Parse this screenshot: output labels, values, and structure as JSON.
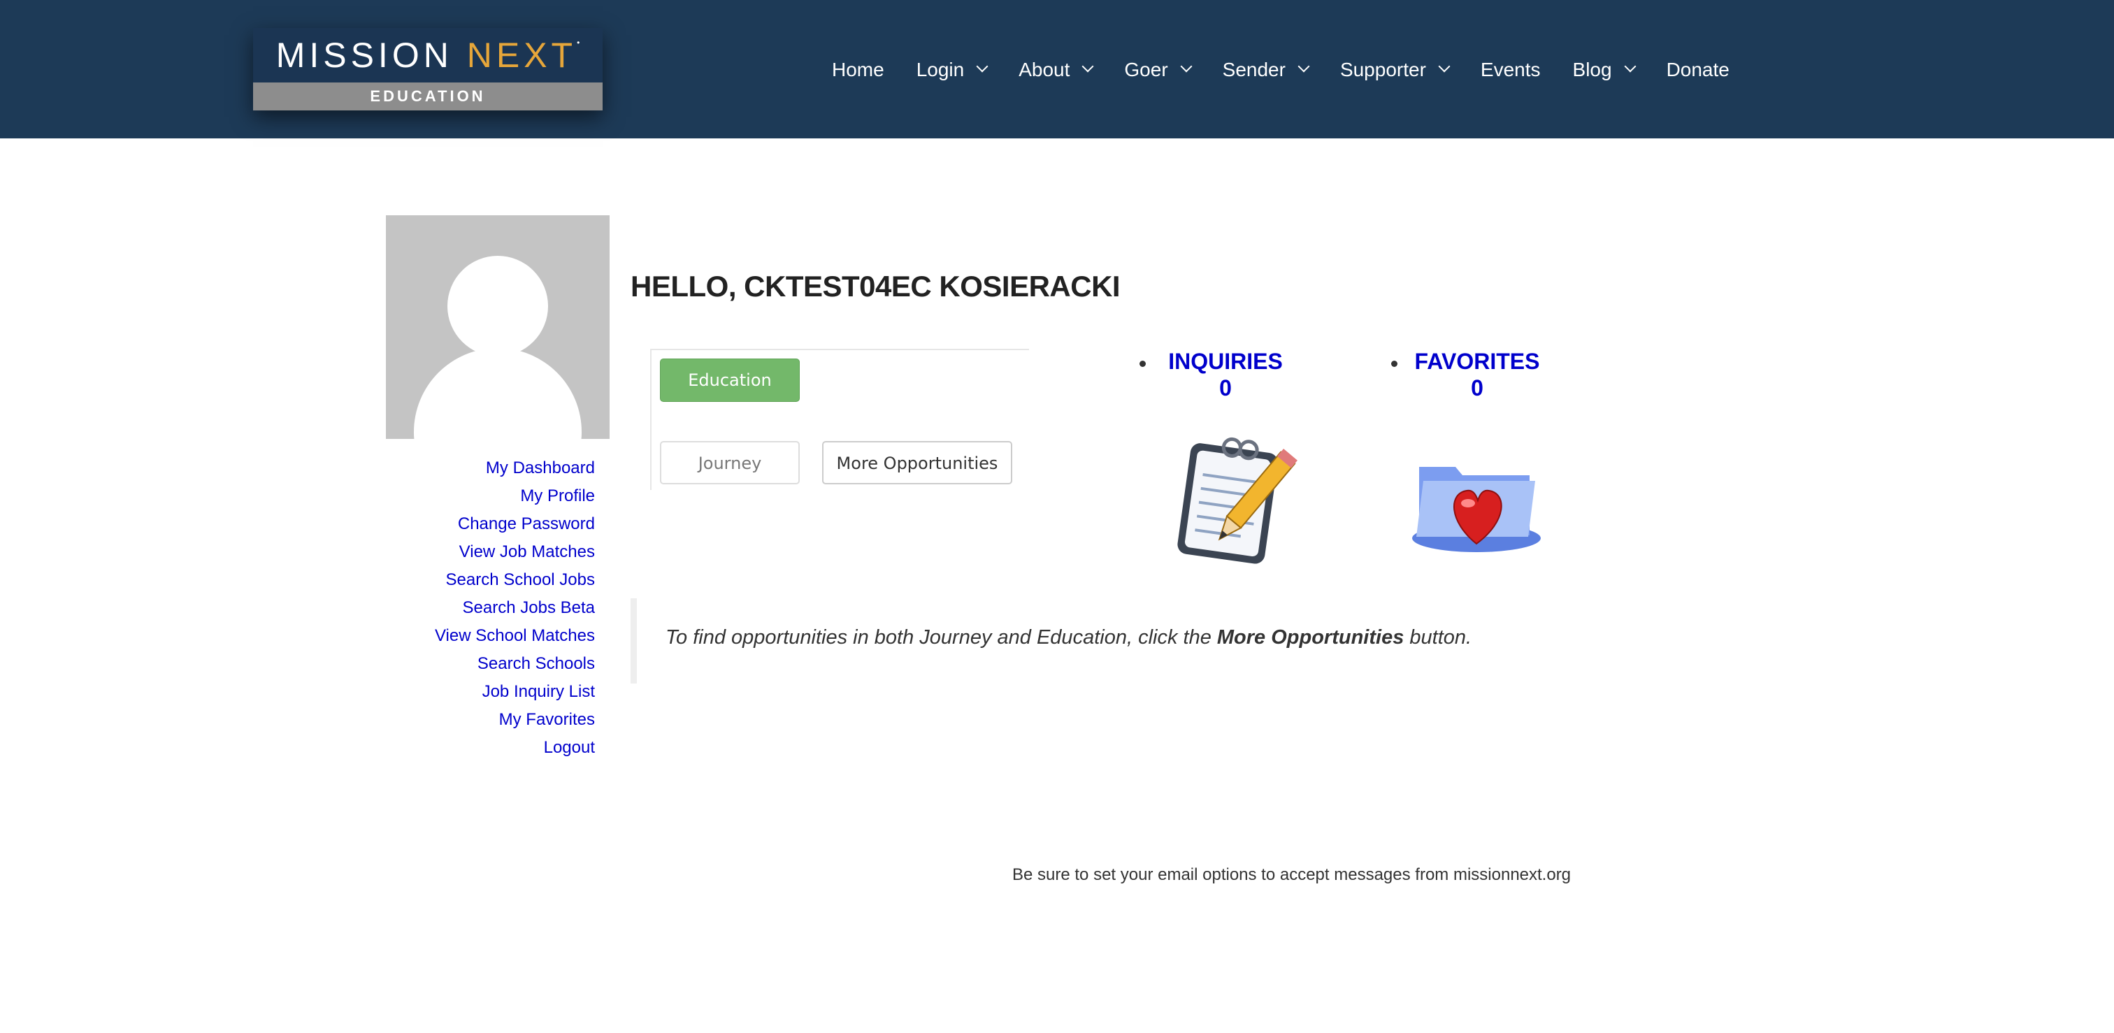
{
  "header": {
    "logo": {
      "word1": "MISSION",
      "word2": "NEXT",
      "tagline": "EDUCATION"
    },
    "nav": [
      {
        "label": "Home",
        "has_dropdown": false
      },
      {
        "label": "Login",
        "has_dropdown": true
      },
      {
        "label": "About",
        "has_dropdown": true
      },
      {
        "label": "Goer",
        "has_dropdown": true
      },
      {
        "label": "Sender",
        "has_dropdown": true
      },
      {
        "label": "Supporter",
        "has_dropdown": true
      },
      {
        "label": "Events",
        "has_dropdown": false
      },
      {
        "label": "Blog",
        "has_dropdown": true
      },
      {
        "label": "Donate",
        "has_dropdown": false
      }
    ]
  },
  "sidebar": {
    "links": [
      "My Dashboard",
      "My Profile",
      "Change Password",
      "View Job Matches",
      "Search School Jobs",
      "Search Jobs Beta",
      "View School Matches",
      "Search Schools",
      "Job Inquiry List",
      "My Favorites",
      "Logout"
    ]
  },
  "main": {
    "greeting": "HELLO, CKTEST04EC KOSIERACKI",
    "tabs": {
      "education": "Education",
      "journey": "Journey",
      "more": "More Opportunities"
    },
    "stats": {
      "inquiries_label": "INQUIRIES",
      "inquiries_count": "0",
      "favorites_label": "FAVORITES",
      "favorites_count": "0"
    },
    "note": {
      "prefix": "To find opportunities in both Journey and Education, click the ",
      "bold": "More Opportunities",
      "suffix": " button."
    },
    "footer_message": "Be sure to set your email options to accept messages from missionnext.org"
  },
  "colors": {
    "header_bg": "#1d3a57",
    "accent_orange": "#e6a63a",
    "link_blue": "#0000cc",
    "education_green": "#73b86a"
  },
  "icons": [
    "chevron-down-icon",
    "avatar-placeholder",
    "notepad-pencil-icon",
    "heart-folder-icon"
  ]
}
